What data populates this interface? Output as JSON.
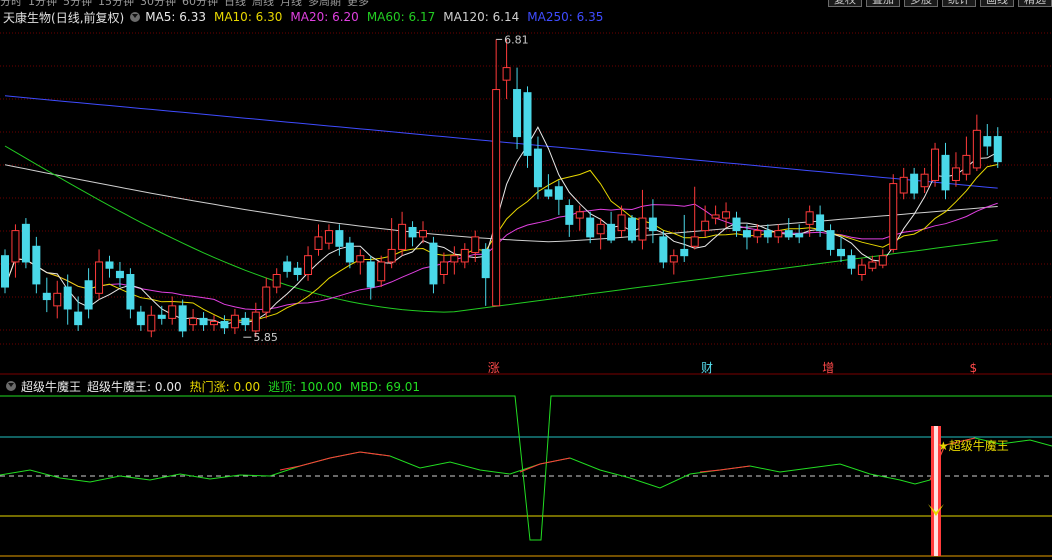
{
  "tabs": [
    "分时",
    "1分钟",
    "5分钟",
    "15分钟",
    "30分钟",
    "60分钟",
    "日线",
    "周线",
    "月线",
    "多周期",
    "更多"
  ],
  "top_buttons": [
    "复权",
    "叠加",
    "多股",
    "统计",
    "画线",
    "精选"
  ],
  "stock": {
    "name": "天康生物",
    "mode": "(日线,前复权)"
  },
  "ma_labels": [
    {
      "text": "MA5: 6.33",
      "color": "#e8e8e8"
    },
    {
      "text": "MA10: 6.30",
      "color": "#e8d800"
    },
    {
      "text": "MA20: 6.20",
      "color": "#e040e0"
    },
    {
      "text": "MA60: 6.17",
      "color": "#22cc22"
    },
    {
      "text": "MA120: 6.14",
      "color": "#cfcfcf"
    },
    {
      "text": "MA250: 6.35",
      "color": "#3f4cff"
    }
  ],
  "annotations": {
    "high": "6.81",
    "low": "5.85"
  },
  "markers": [
    "涨",
    "财",
    "增",
    "$"
  ],
  "indicator": {
    "name": "超级牛魔王",
    "items": [
      {
        "text": "超级牛魔王: 0.00",
        "color": "#e8e8e8"
      },
      {
        "text": "热门涨: 0.00",
        "color": "#e8d800"
      },
      {
        "text": "逃顶: 100.00",
        "color": "#22dd22"
      },
      {
        "text": "MBD: 69.01",
        "color": "#22dd22"
      }
    ],
    "signal": "★超级牛魔王"
  },
  "colors": {
    "up": "#ff3b3b",
    "down": "#4ad8e8",
    "grid": "#6e0000"
  },
  "candles": [
    [
      5,
      6.12,
      6.02,
      6.14,
      6.0
    ],
    [
      6,
      6.1,
      6.2,
      6.22,
      6.05
    ],
    [
      7,
      6.22,
      6.1,
      6.24,
      6.08
    ],
    [
      8,
      6.15,
      6.03,
      6.18,
      6.0
    ],
    [
      9,
      6.0,
      5.98,
      6.05,
      5.94
    ],
    [
      10,
      5.96,
      6.0,
      6.04,
      5.92
    ],
    [
      11,
      6.02,
      5.95,
      6.06,
      5.9
    ],
    [
      12,
      5.94,
      5.9,
      5.99,
      5.88
    ],
    [
      13,
      6.04,
      5.95,
      6.08,
      5.92
    ],
    [
      14,
      6.0,
      6.1,
      6.14,
      5.98
    ],
    [
      15,
      6.1,
      6.08,
      6.12,
      6.05
    ],
    [
      16,
      6.07,
      6.05,
      6.1,
      6.02
    ],
    [
      17,
      6.06,
      5.95,
      6.08,
      5.92
    ],
    [
      18,
      5.94,
      5.9,
      5.96,
      5.88
    ],
    [
      19,
      5.88,
      5.93,
      5.96,
      5.86
    ],
    [
      20,
      5.93,
      5.92,
      5.96,
      5.9
    ],
    [
      21,
      5.92,
      5.96,
      5.99,
      5.9
    ],
    [
      22,
      5.96,
      5.88,
      5.98,
      5.86
    ],
    [
      23,
      5.9,
      5.92,
      5.95,
      5.88
    ],
    [
      24,
      5.92,
      5.9,
      5.94,
      5.88
    ],
    [
      25,
      5.9,
      5.91,
      5.93,
      5.88
    ],
    [
      26,
      5.91,
      5.89,
      5.93,
      5.87
    ],
    [
      27,
      5.89,
      5.93,
      5.95,
      5.87
    ],
    [
      28,
      5.92,
      5.9,
      5.94,
      5.88
    ],
    [
      29,
      5.88,
      5.94,
      5.97,
      5.86
    ],
    [
      30,
      5.94,
      6.02,
      6.05,
      5.92
    ],
    [
      31,
      6.02,
      6.06,
      6.08,
      6.0
    ],
    [
      32,
      6.1,
      6.07,
      6.12,
      6.05
    ],
    [
      33,
      6.08,
      6.06,
      6.1,
      6.04
    ],
    [
      34,
      6.06,
      6.12,
      6.15,
      6.04
    ],
    [
      35,
      6.14,
      6.18,
      6.22,
      6.12
    ],
    [
      36,
      6.16,
      6.2,
      6.22,
      6.14
    ],
    [
      37,
      6.2,
      6.15,
      6.22,
      6.12
    ],
    [
      38,
      6.16,
      6.1,
      6.18,
      6.08
    ],
    [
      39,
      6.1,
      6.12,
      6.14,
      6.06
    ],
    [
      40,
      6.1,
      6.02,
      6.12,
      5.98
    ],
    [
      41,
      6.04,
      6.1,
      6.12,
      6.02
    ],
    [
      42,
      6.1,
      6.14,
      6.24,
      6.08
    ],
    [
      43,
      6.14,
      6.22,
      6.26,
      6.12
    ],
    [
      44,
      6.21,
      6.18,
      6.23,
      6.15
    ],
    [
      45,
      6.18,
      6.2,
      6.23,
      6.16
    ],
    [
      46,
      6.16,
      6.03,
      6.18,
      6.0
    ],
    [
      47,
      6.06,
      6.1,
      6.13,
      6.03
    ],
    [
      48,
      6.1,
      6.12,
      6.15,
      6.06
    ],
    [
      49,
      6.1,
      6.14,
      6.16,
      6.08
    ],
    [
      50,
      6.13,
      6.18,
      6.2,
      6.1
    ],
    [
      51,
      6.14,
      6.05,
      6.16,
      5.96
    ],
    [
      52,
      5.96,
      6.65,
      6.81,
      5.96
    ],
    [
      53,
      6.68,
      6.72,
      6.81,
      6.62
    ],
    [
      54,
      6.65,
      6.5,
      6.72,
      6.46
    ],
    [
      55,
      6.64,
      6.44,
      6.66,
      6.4
    ],
    [
      56,
      6.46,
      6.34,
      6.5,
      6.3
    ],
    [
      57,
      6.33,
      6.31,
      6.38,
      6.3
    ],
    [
      58,
      6.34,
      6.3,
      6.36,
      6.25
    ],
    [
      59,
      6.28,
      6.22,
      6.3,
      6.18
    ],
    [
      60,
      6.24,
      6.26,
      6.28,
      6.2
    ],
    [
      61,
      6.24,
      6.18,
      6.26,
      6.16
    ],
    [
      62,
      6.19,
      6.22,
      6.24,
      6.14
    ],
    [
      63,
      6.22,
      6.17,
      6.26,
      6.16
    ],
    [
      64,
      6.2,
      6.25,
      6.28,
      6.18
    ],
    [
      65,
      6.24,
      6.17,
      6.25,
      6.16
    ],
    [
      66,
      6.17,
      6.24,
      6.33,
      6.14
    ],
    [
      67,
      6.24,
      6.2,
      6.3,
      6.16
    ],
    [
      68,
      6.18,
      6.1,
      6.2,
      6.08
    ],
    [
      69,
      6.1,
      6.12,
      6.14,
      6.06
    ],
    [
      70,
      6.14,
      6.12,
      6.25,
      6.1
    ],
    [
      71,
      6.15,
      6.18,
      6.34,
      6.14
    ],
    [
      72,
      6.2,
      6.23,
      6.28,
      6.18
    ],
    [
      73,
      6.24,
      6.25,
      6.28,
      6.22
    ],
    [
      74,
      6.24,
      6.26,
      6.29,
      6.21
    ],
    [
      75,
      6.24,
      6.2,
      6.26,
      6.18
    ],
    [
      76,
      6.2,
      6.18,
      6.22,
      6.14
    ],
    [
      77,
      6.18,
      6.2,
      6.22,
      6.16
    ],
    [
      78,
      6.2,
      6.18,
      6.22,
      6.16
    ],
    [
      79,
      6.18,
      6.2,
      6.22,
      6.16
    ],
    [
      80,
      6.2,
      6.18,
      6.24,
      6.17
    ],
    [
      81,
      6.19,
      6.18,
      6.22,
      6.16
    ],
    [
      82,
      6.22,
      6.26,
      6.28,
      6.18
    ],
    [
      83,
      6.25,
      6.2,
      6.28,
      6.18
    ],
    [
      84,
      6.2,
      6.14,
      6.22,
      6.12
    ],
    [
      85,
      6.14,
      6.12,
      6.18,
      6.1
    ],
    [
      86,
      6.12,
      6.08,
      6.14,
      6.06
    ],
    [
      87,
      6.06,
      6.09,
      6.11,
      6.04
    ],
    [
      88,
      6.08,
      6.1,
      6.12,
      6.07
    ],
    [
      89,
      6.09,
      6.12,
      6.14,
      6.08
    ],
    [
      90,
      6.14,
      6.35,
      6.38,
      6.13
    ],
    [
      91,
      6.32,
      6.37,
      6.4,
      6.3
    ],
    [
      92,
      6.38,
      6.32,
      6.4,
      6.3
    ],
    [
      93,
      6.34,
      6.38,
      6.4,
      6.32
    ],
    [
      94,
      6.36,
      6.46,
      6.48,
      6.34
    ],
    [
      95,
      6.44,
      6.33,
      6.48,
      6.3
    ],
    [
      96,
      6.36,
      6.4,
      6.45,
      6.34
    ],
    [
      97,
      6.38,
      6.44,
      6.5,
      6.36
    ],
    [
      98,
      6.4,
      6.52,
      6.57,
      6.39
    ],
    [
      99,
      6.5,
      6.47,
      6.54,
      6.44
    ],
    [
      100,
      6.5,
      6.42,
      6.53,
      6.4
    ]
  ]
}
